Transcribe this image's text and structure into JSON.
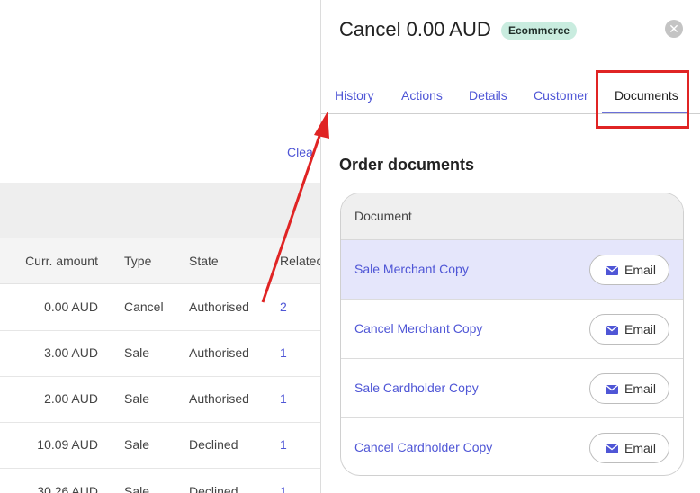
{
  "background": {
    "clear_link": "Clea",
    "table": {
      "headers": {
        "amount": "Curr. amount",
        "type": "Type",
        "state": "State",
        "related": "Relatec"
      },
      "rows": [
        {
          "amount": "0.00 AUD",
          "type": "Cancel",
          "state": "Authorised",
          "related": "2"
        },
        {
          "amount": "3.00 AUD",
          "type": "Sale",
          "state": "Authorised",
          "related": "1"
        },
        {
          "amount": "2.00 AUD",
          "type": "Sale",
          "state": "Authorised",
          "related": "1"
        },
        {
          "amount": "10.09 AUD",
          "type": "Sale",
          "state": "Declined",
          "related": "1"
        },
        {
          "amount": "30.26 AUD",
          "type": "Sale",
          "state": "Declined",
          "related": "1"
        }
      ]
    }
  },
  "panel": {
    "title": "Cancel 0.00 AUD",
    "badge": "Ecommerce",
    "close_icon": "close-icon",
    "tabs": [
      {
        "label": "History"
      },
      {
        "label": "Actions"
      },
      {
        "label": "Details"
      },
      {
        "label": "Customer"
      },
      {
        "label": "Documents",
        "active": true
      }
    ],
    "section_title": "Order documents",
    "documents": {
      "header": "Document",
      "items": [
        {
          "name": "Sale Merchant Copy",
          "action": "Email",
          "highlighted": true
        },
        {
          "name": "Cancel Merchant Copy",
          "action": "Email"
        },
        {
          "name": "Sale Cardholder Copy",
          "action": "Email"
        },
        {
          "name": "Cancel Cardholder Copy",
          "action": "Email"
        }
      ]
    }
  },
  "colors": {
    "accent": "#4f56d6",
    "badge_bg": "#c9ecdf",
    "highlight_row": "#e5e6fb",
    "annotation": "#e02424"
  }
}
